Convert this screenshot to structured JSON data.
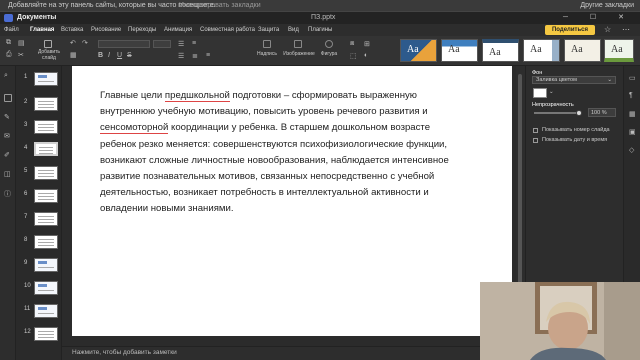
{
  "bookmarks_bar": {
    "message": "Добавляйте на эту панель сайты, которые вы часто посещаете.",
    "import_link": "Импортировать закладки",
    "other_bookmarks": "Другие закладки"
  },
  "titlebar": {
    "app_name": "Документы",
    "file_name": "ПЗ.pptx",
    "window_controls": "─ ☐ ✕"
  },
  "menu": {
    "tabs": [
      "Файл",
      "Главная",
      "Вставка",
      "Рисование",
      "Переходы",
      "Анимация",
      "Совместная работа",
      "Защита",
      "Вид",
      "Плагины"
    ],
    "active_tab": "Главная",
    "share_label": "Поделиться"
  },
  "toolbar": {
    "add_slide_label": "Добавить слайд",
    "textbox_label": "Надпись",
    "image_label": "Изображение",
    "shape_label": "Фигура",
    "theme_sample": "Aa"
  },
  "slides": {
    "numbers": [
      "1",
      "2",
      "3",
      "4",
      "5",
      "6",
      "7",
      "8",
      "9",
      "10",
      "11",
      "12"
    ],
    "selected_index": 3
  },
  "slide": {
    "text_before_1": "Главные цели ",
    "underlined_1": "предшкольной",
    "text_mid_1": " подготовки – сформировать выраженную внутреннюю учебную мотивацию, повысить уровень речевого развития и ",
    "underlined_2": "сенсомоторной",
    "text_after": " координации у ребенка. В старшем дошкольном возрасте ребенок резко меняется: совершенствуются психофизиологические функции, возникают сложные личностные новообразования, наблюдается интенсивное развитие познавательных мотивов, связанных непосредственно с учебной деятельностью, возникает потребность в интеллектуальной активности и овладении новыми знаниями."
  },
  "notes_placeholder": "Нажмите, чтобы добавить заметки",
  "right_panel": {
    "background_label": "Фон",
    "fill_select": "Заливка цветом",
    "opacity_label": "Непрозрачность",
    "opacity_value": "100 %",
    "opacity_percent": 100,
    "show_slide_number": "Показывать номер слайда",
    "show_date_time": "Показывать дату и время"
  },
  "colors": {
    "accent": "#f5c842",
    "slide_bg": "#ffffff",
    "app_bg": "#2b2b2b"
  }
}
